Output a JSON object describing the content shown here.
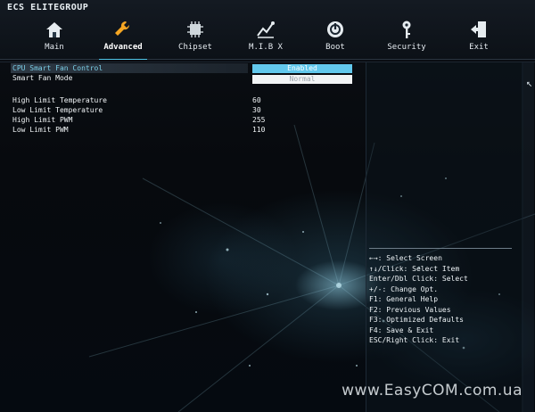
{
  "brand": "ECS ELITEGROUP",
  "nav": [
    {
      "label": "Main",
      "icon": "home-icon"
    },
    {
      "label": "Advanced",
      "icon": "wrench-icon",
      "active": true
    },
    {
      "label": "Chipset",
      "icon": "chip-icon"
    },
    {
      "label": "M.I.B X",
      "icon": "graph-icon"
    },
    {
      "label": "Boot",
      "icon": "power-icon"
    },
    {
      "label": "Security",
      "icon": "key-icon"
    },
    {
      "label": "Exit",
      "icon": "exit-icon"
    }
  ],
  "settings": {
    "cpu_smart_fan_control": {
      "label": "CPU Smart Fan Control",
      "value": "Enabled"
    },
    "smart_fan_mode": {
      "label": "Smart Fan Mode",
      "value": "Normal"
    },
    "high_limit_temperature": {
      "label": "High Limit Temperature",
      "value": "60"
    },
    "low_limit_temperature": {
      "label": "Low Limit Temperature",
      "value": "30"
    },
    "high_limit_pwm": {
      "label": "High Limit PWM",
      "value": "255"
    },
    "low_limit_pwm": {
      "label": "Low Limit PWM",
      "value": "110"
    }
  },
  "help": [
    "←→: Select Screen",
    "↑↓/Click: Select Item",
    "Enter/Dbl Click: Select",
    "+/-: Change Opt.",
    "F1: General Help",
    "F2: Previous Values",
    "F3: Optimized Defaults",
    "F4: Save & Exit",
    "ESC/Right Click: Exit"
  ],
  "watermark": "www.EasyCOM.com.ua",
  "colors": {
    "accent": "#62c8ec",
    "text": "#f0f4f6"
  }
}
